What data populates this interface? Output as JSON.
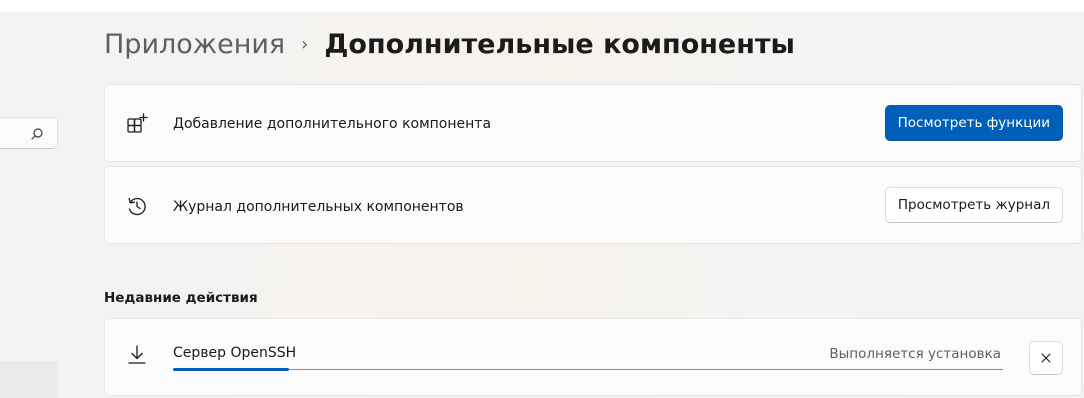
{
  "breadcrumb": {
    "parent": "Приложения",
    "separator": "›",
    "current": "Дополнительные компоненты"
  },
  "add_feature": {
    "label": "Добавление дополнительного компонента",
    "button_label": "Посмотреть функции",
    "icon": "add-apps-icon"
  },
  "history": {
    "label": "Журнал дополнительных компонентов",
    "button_label": "Просмотреть журнал",
    "icon": "history-icon"
  },
  "recent": {
    "section_title": "Недавние действия",
    "items": [
      {
        "name": "Сервер OpenSSH",
        "status": "Выполняется установка",
        "progress": 0.14,
        "icon": "download-icon",
        "cancel_icon": "close-icon"
      }
    ]
  },
  "search": {
    "icon": "search-icon"
  },
  "colors": {
    "accent": "#005fb8",
    "card_background": "#fbfbfb",
    "secondary_text": "#5f5f5f"
  }
}
